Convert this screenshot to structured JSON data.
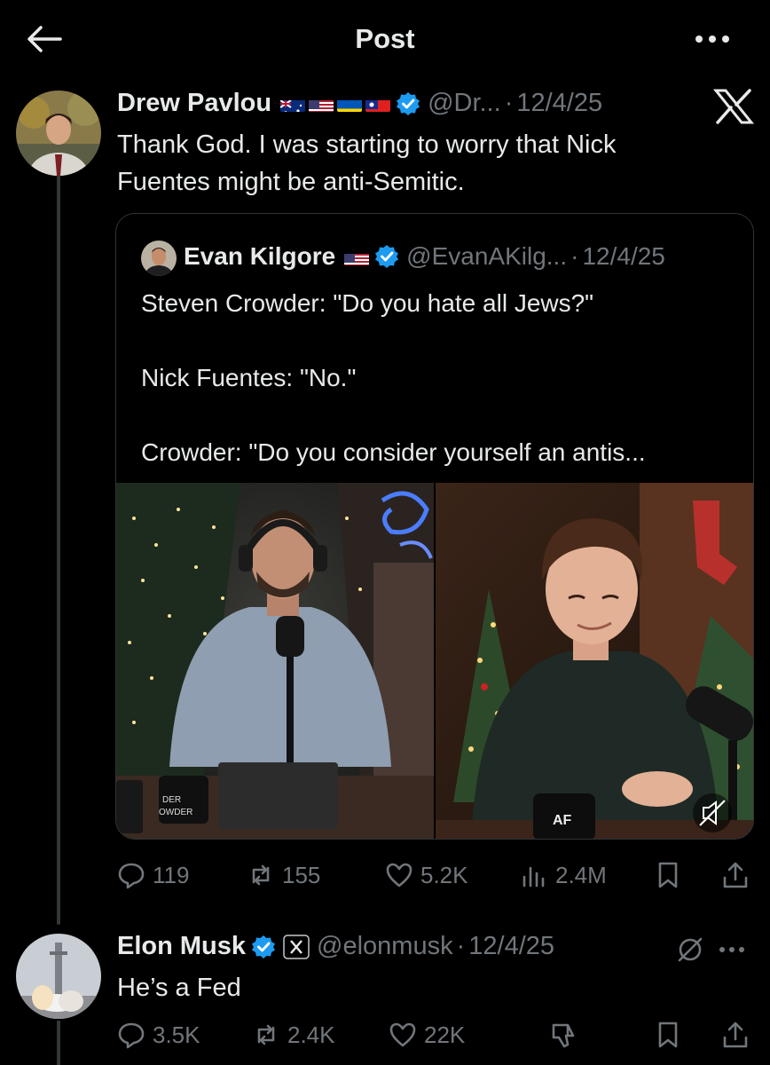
{
  "header": {
    "title": "Post"
  },
  "main_post": {
    "author_name": "Drew Pavlou",
    "handle": "@Dr...",
    "separator": "·",
    "time": "12/4/25",
    "text": "Thank God. I was starting to worry that Nick\nFuentes might be anti-Semitic.",
    "flags": [
      "australia-flag",
      "usa-flag",
      "ukraine-flag",
      "taiwan-flag"
    ]
  },
  "quoted_post": {
    "author_name": "Evan Kilgore",
    "handle": "@EvanAKilg...",
    "separator": "·",
    "time": "12/4/25",
    "text": "Steven Crowder: \"Do you hate all Jews?\"\n\nNick Fuentes: \"No.\"\n\nCrowder: \"Do you consider yourself an antis...",
    "media_mug_text": "DER\nOWDER",
    "media_mug_right_text": "AF"
  },
  "main_actions": {
    "replies": "119",
    "reposts": "155",
    "likes": "5.2K",
    "views": "2.4M"
  },
  "reply_post": {
    "author_name": "Elon Musk",
    "handle": "@elonmusk",
    "separator": "·",
    "time": "12/4/25",
    "text": "He’s a Fed"
  },
  "reply_actions": {
    "replies": "3.5K",
    "reposts": "2.4K",
    "likes": "22K"
  },
  "colors": {
    "background": "#000000",
    "text": "#e7e9ea",
    "muted": "#71767b",
    "verified": "#1d9bf0",
    "border": "#2f3336"
  }
}
